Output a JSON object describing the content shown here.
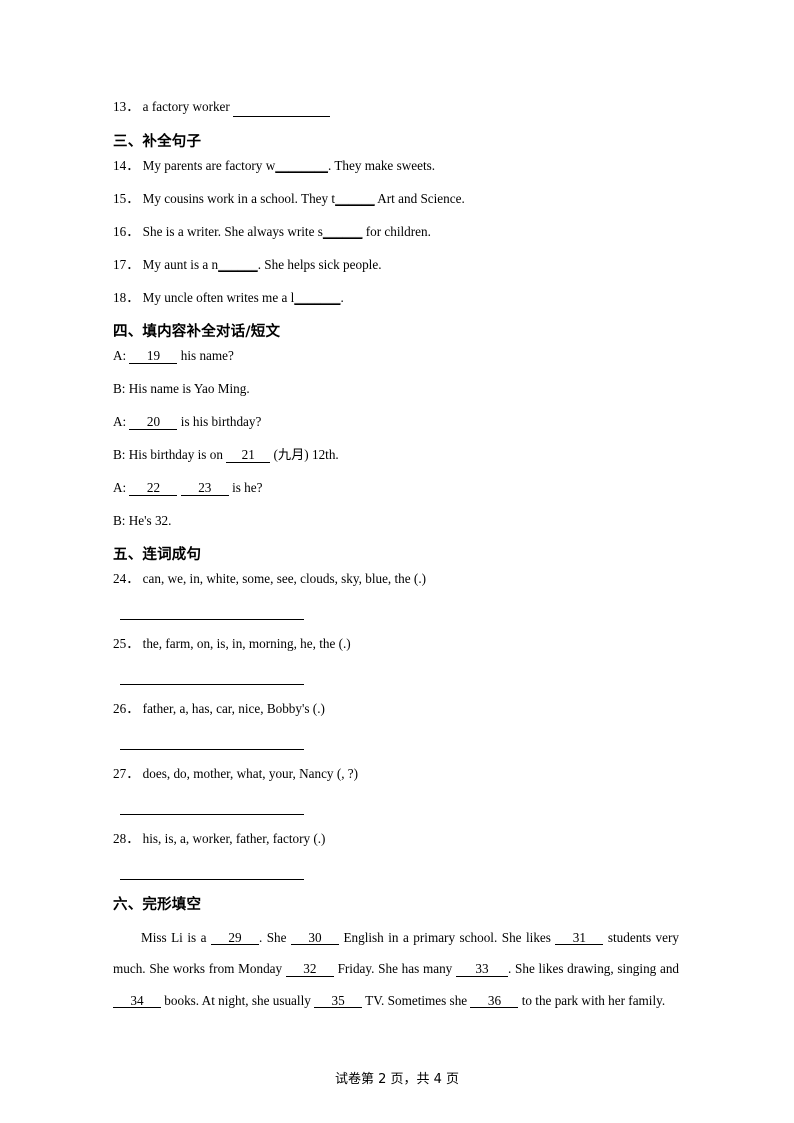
{
  "document": {
    "type": "exam-paper",
    "page_footer": "试卷第 2 页，共 4 页"
  },
  "items": {
    "q13": {
      "number": "13．",
      "text": "a factory worker"
    }
  },
  "sections": [
    {
      "id": "section-3",
      "heading": "三、补全句子",
      "questions": [
        {
          "number": "14．",
          "before": "My parents are factory w",
          "blank": "________",
          "after": ". They make sweets."
        },
        {
          "number": "15．",
          "before": "My cousins work in a school. They t",
          "blank": "______",
          "after": " Art and Science."
        },
        {
          "number": "16．",
          "before": "She is a writer. She always write s",
          "blank": "______",
          "after": " for children."
        },
        {
          "number": "17．",
          "before": "My aunt is a n",
          "blank": "______",
          "after": ". She helps sick people."
        },
        {
          "number": "18．",
          "before": "My uncle often writes me a l",
          "blank": "_______",
          "after": "."
        }
      ]
    },
    {
      "id": "section-4",
      "heading": "四、填内容补全对话/短文",
      "dialogue": [
        {
          "speaker": "A:",
          "parts": [
            {
              "type": "blank",
              "value": "19"
            },
            {
              "type": "text",
              "value": " his name?"
            }
          ]
        },
        {
          "speaker": "B:",
          "parts": [
            {
              "type": "text",
              "value": " His name is Yao Ming."
            }
          ]
        },
        {
          "speaker": "A:",
          "parts": [
            {
              "type": "blank",
              "value": "20"
            },
            {
              "type": "text",
              "value": " is his birthday?"
            }
          ]
        },
        {
          "speaker": "B:",
          "parts": [
            {
              "type": "text",
              "value": " His birthday is on "
            },
            {
              "type": "blank",
              "value": "21"
            },
            {
              "type": "text",
              "value": " (九月) 12th."
            }
          ]
        },
        {
          "speaker": "A:",
          "parts": [
            {
              "type": "blank",
              "value": "22"
            },
            {
              "type": "blank",
              "value": "23"
            },
            {
              "type": "text",
              "value": " is he?"
            }
          ]
        },
        {
          "speaker": "B:",
          "parts": [
            {
              "type": "text",
              "value": " He's 32."
            }
          ]
        }
      ]
    },
    {
      "id": "section-5",
      "heading": "五、连词成句",
      "questions": [
        {
          "number": "24．",
          "text": "can, we, in, white, some, see, clouds, sky, blue, the (.)"
        },
        {
          "number": "25．",
          "text": "the, farm, on, is, in, morning, he, the (.)"
        },
        {
          "number": "26．",
          "text": "father, a, has, car, nice, Bobby's (.)"
        },
        {
          "number": "27．",
          "text": "does, do, mother, what, your, Nancy (, ?)"
        },
        {
          "number": "28．",
          "text": "his, is, a, worker, father, factory (.)"
        }
      ]
    },
    {
      "id": "section-6",
      "heading": "六、完形填空",
      "cloze": {
        "segments": [
          {
            "type": "text",
            "value": "Miss Li is a "
          },
          {
            "type": "blank",
            "value": "29"
          },
          {
            "type": "text",
            "value": ". She "
          },
          {
            "type": "blank",
            "value": "30"
          },
          {
            "type": "text",
            "value": " English in a primary school. She likes "
          },
          {
            "type": "blank",
            "value": "31"
          },
          {
            "type": "text",
            "value": " students very much. She works from Monday "
          },
          {
            "type": "blank",
            "value": "32"
          },
          {
            "type": "text",
            "value": " Friday. She has many "
          },
          {
            "type": "blank",
            "value": "33"
          },
          {
            "type": "text",
            "value": ". She likes drawing, singing and "
          },
          {
            "type": "blank",
            "value": "34"
          },
          {
            "type": "text",
            "value": " books. At night, she usually "
          },
          {
            "type": "blank",
            "value": "35"
          },
          {
            "type": "text",
            "value": " TV. Sometimes she "
          },
          {
            "type": "blank",
            "value": "36"
          },
          {
            "type": "text",
            "value": " to the park with her family."
          }
        ]
      }
    }
  ]
}
